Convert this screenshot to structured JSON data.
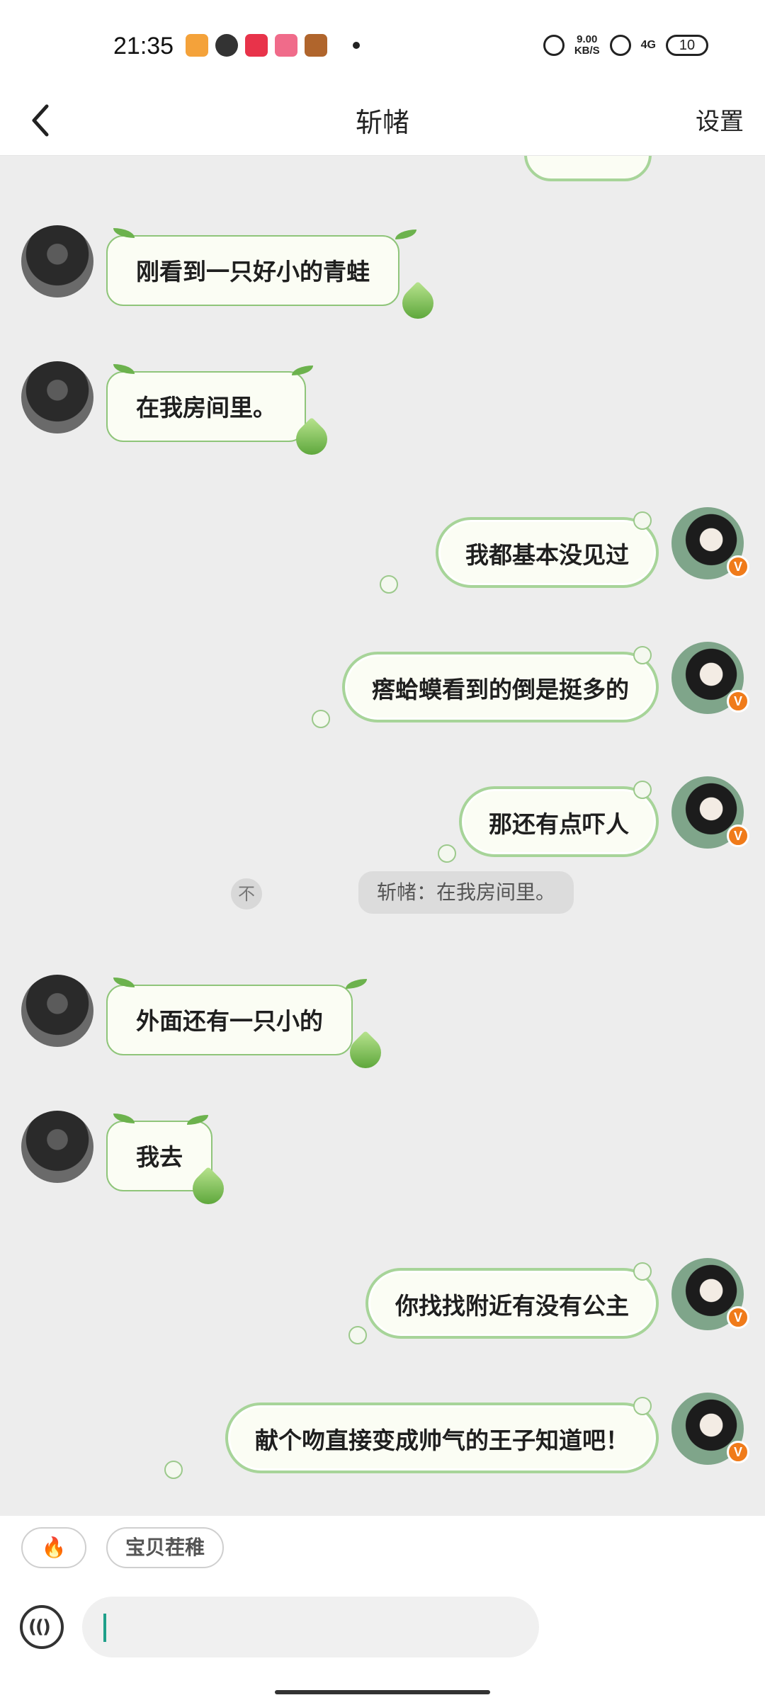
{
  "status_bar": {
    "time": "21:35",
    "speed": "9.00",
    "speed_unit": "KB/S",
    "network": "4G",
    "battery": "10"
  },
  "header": {
    "title": "斩帾",
    "settings_label": "设置"
  },
  "messages": [
    {
      "side": "left",
      "text": "刚看到一只好小的青蛙"
    },
    {
      "side": "left",
      "text": "在我房间里。"
    },
    {
      "side": "right",
      "text": "我都基本没见过"
    },
    {
      "side": "right",
      "text": "瘩蛤蟆看到的倒是挺多的"
    },
    {
      "side": "right",
      "text": "那还有点吓人"
    },
    {
      "side": "left",
      "text": "外面还有一只小的"
    },
    {
      "side": "left",
      "text": "我去"
    },
    {
      "side": "right",
      "text": "你找找附近有没有公主"
    },
    {
      "side": "right",
      "text": "献个吻直接变成帅气的王子知道吧！"
    }
  ],
  "quote": {
    "icon": "不",
    "text": "斩帾：在我房间里。"
  },
  "quick_replies": {
    "fire": "🔥",
    "chip": "宝贝茬稚"
  },
  "input": {
    "placeholder": ""
  },
  "badge": "V"
}
